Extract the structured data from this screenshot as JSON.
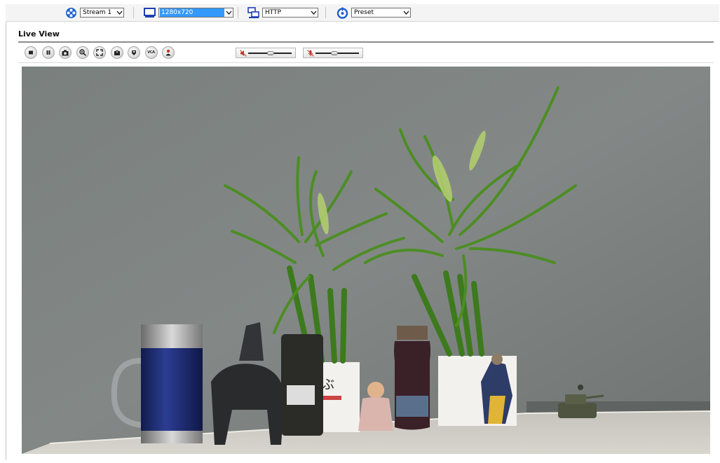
{
  "toolbar": {
    "stream": {
      "icon": "stream-icon",
      "value": "Stream 1"
    },
    "resolution": {
      "icon": "monitor-icon",
      "value": "1280x720"
    },
    "protocol": {
      "icon": "network-icon",
      "value": "HTTP"
    },
    "preset": {
      "icon": "preset-icon",
      "value": "Preset"
    }
  },
  "page": {
    "title": "Live View"
  },
  "controls": [
    {
      "name": "stop-icon"
    },
    {
      "name": "pause-icon"
    },
    {
      "name": "snapshot-icon"
    },
    {
      "name": "zoom-icon"
    },
    {
      "name": "fullscreen-icon"
    },
    {
      "name": "record-icon"
    },
    {
      "name": "alarm-icon"
    },
    {
      "name": "vca-icon",
      "label": "VCA"
    },
    {
      "name": "person-icon"
    }
  ],
  "audio": {
    "speaker_volume_icon": "speaker-muted-icon",
    "mic_volume_icon": "mic-muted-icon",
    "speaker_level": 0.5,
    "mic_level": 0.42
  },
  "video": {
    "description_hidden": true
  },
  "colors": {
    "accent": "#3399ff",
    "toolbar_bg": "#f4f4f4"
  }
}
